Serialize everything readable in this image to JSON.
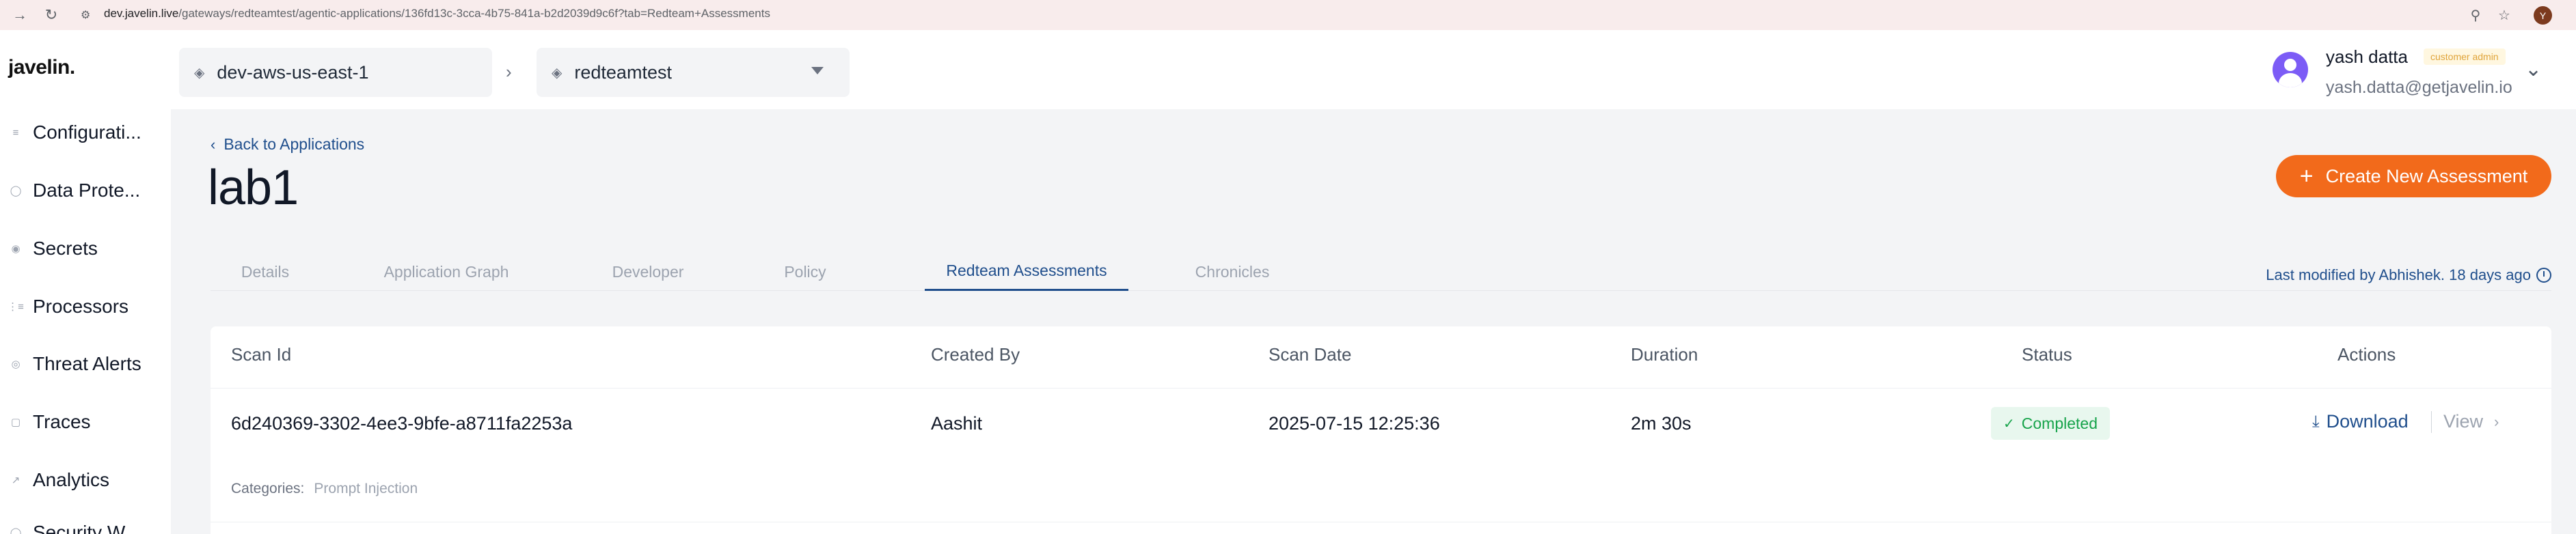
{
  "browser": {
    "url_host": "dev.javelin.live",
    "url_path": "/gateways/redteamtest/agentic-applications/136fd13c-3cca-4b75-841a-b2d2039d9c6f?tab=Redteam+Assessments",
    "profile_initial": "Y"
  },
  "app": {
    "logo": "javelin."
  },
  "sidebar": {
    "items": [
      {
        "label": "Configurati...",
        "icon": "sliders-icon"
      },
      {
        "label": "Data Prote...",
        "icon": "shield-icon"
      },
      {
        "label": "Secrets",
        "icon": "key-icon"
      },
      {
        "label": "Processors",
        "icon": "list-icon"
      },
      {
        "label": "Threat Alerts",
        "icon": "alert-icon"
      },
      {
        "label": "Traces",
        "icon": "square-icon"
      },
      {
        "label": "Analytics",
        "icon": "chart-icon"
      },
      {
        "label": "Security W...",
        "icon": "shield-icon"
      }
    ]
  },
  "topbar": {
    "gateway_selector": "dev-aws-us-east-1",
    "project_selector": "redteamtest",
    "user_name": "yash datta",
    "user_role": "customer admin",
    "user_email": "yash.datta@getjavelin.io"
  },
  "page": {
    "back_label": "Back to Applications",
    "title": "lab1",
    "create_button": "Create New Assessment",
    "last_modified": "Last modified by Abhishek. 18 days ago",
    "tabs": [
      {
        "label": "Details"
      },
      {
        "label": "Application Graph"
      },
      {
        "label": "Developer"
      },
      {
        "label": "Policy"
      },
      {
        "label": "Redteam Assessments"
      },
      {
        "label": "Chronicles"
      }
    ],
    "active_tab": "Redteam Assessments"
  },
  "table": {
    "headers": {
      "scan_id": "Scan Id",
      "created_by": "Created By",
      "scan_date": "Scan Date",
      "duration": "Duration",
      "status": "Status",
      "actions": "Actions"
    },
    "rows": [
      {
        "scan_id": "6d240369-3302-4ee3-9bfe-a8711fa2253a",
        "created_by": "Aashit",
        "scan_date": "2025-07-15 12:25:36",
        "duration": "2m 30s",
        "status": "Completed",
        "download_label": "Download",
        "view_label": "View",
        "categories_label": "Categories:",
        "categories_value": "Prompt Injection"
      }
    ]
  },
  "colors": {
    "accent": "#f26a1b",
    "link": "#1f4e8c",
    "success": "#16a34a"
  }
}
